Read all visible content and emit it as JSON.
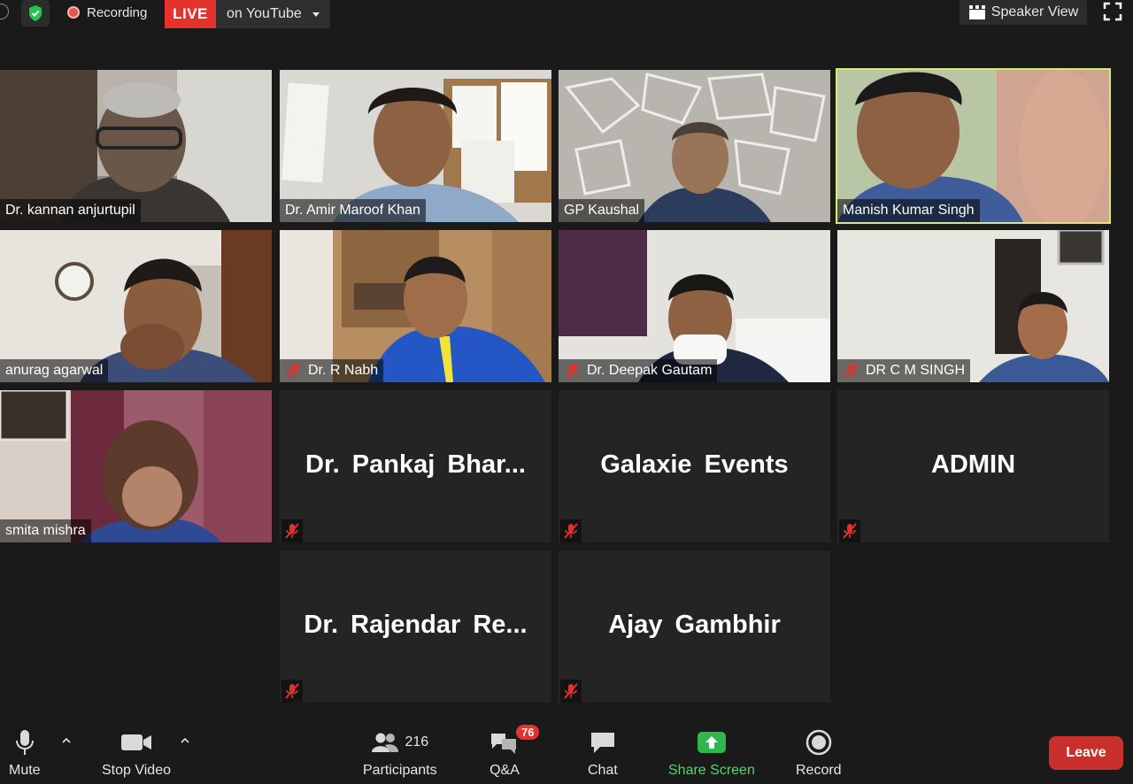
{
  "topbar": {
    "recording_label": "Recording",
    "live_badge": "LIVE",
    "live_destination": "on YouTube",
    "view_toggle": "Speaker View"
  },
  "participants_grid": [
    {
      "name": "Dr. kannan anjurtupil",
      "video": true,
      "muted": false,
      "active_speaker": false
    },
    {
      "name": "Dr. Amir Maroof Khan",
      "video": true,
      "muted": false,
      "active_speaker": false
    },
    {
      "name": "GP Kaushal",
      "video": true,
      "muted": false,
      "active_speaker": false
    },
    {
      "name": "Manish Kumar Singh",
      "video": true,
      "muted": false,
      "active_speaker": true
    },
    {
      "name": "anurag agarwal",
      "video": true,
      "muted": false,
      "active_speaker": false
    },
    {
      "name": "Dr. R Nabh",
      "video": true,
      "muted": true,
      "active_speaker": false
    },
    {
      "name": "Dr. Deepak Gautam",
      "video": true,
      "muted": true,
      "active_speaker": false
    },
    {
      "name": "DR C M SINGH",
      "video": true,
      "muted": true,
      "active_speaker": false
    },
    {
      "name": "smita mishra",
      "video": true,
      "muted": false,
      "active_speaker": false
    },
    {
      "name": "Dr. Pankaj Bhar...",
      "video": false,
      "muted": true,
      "active_speaker": false
    },
    {
      "name": "Galaxie Events",
      "video": false,
      "muted": true,
      "active_speaker": false
    },
    {
      "name": "ADMIN",
      "video": false,
      "muted": true,
      "active_speaker": false
    },
    {
      "name": "Dr. Rajendar Re...",
      "video": false,
      "muted": true,
      "active_speaker": false
    },
    {
      "name": "Ajay Gambhir",
      "video": false,
      "muted": true,
      "active_speaker": false
    }
  ],
  "toolbar": {
    "mute": "Mute",
    "stop_video": "Stop Video",
    "participants_count": "216",
    "participants": "Participants",
    "qa_badge": "76",
    "qa": "Q&A",
    "chat": "Chat",
    "share_screen": "Share Screen",
    "record": "Record",
    "leave": "Leave"
  },
  "colors": {
    "background": "#1a1a1a",
    "live_red": "#e5322d",
    "active_speaker_border": "#d9ea6a",
    "share_green": "#4fd46f",
    "leave_red": "#c9302c"
  }
}
